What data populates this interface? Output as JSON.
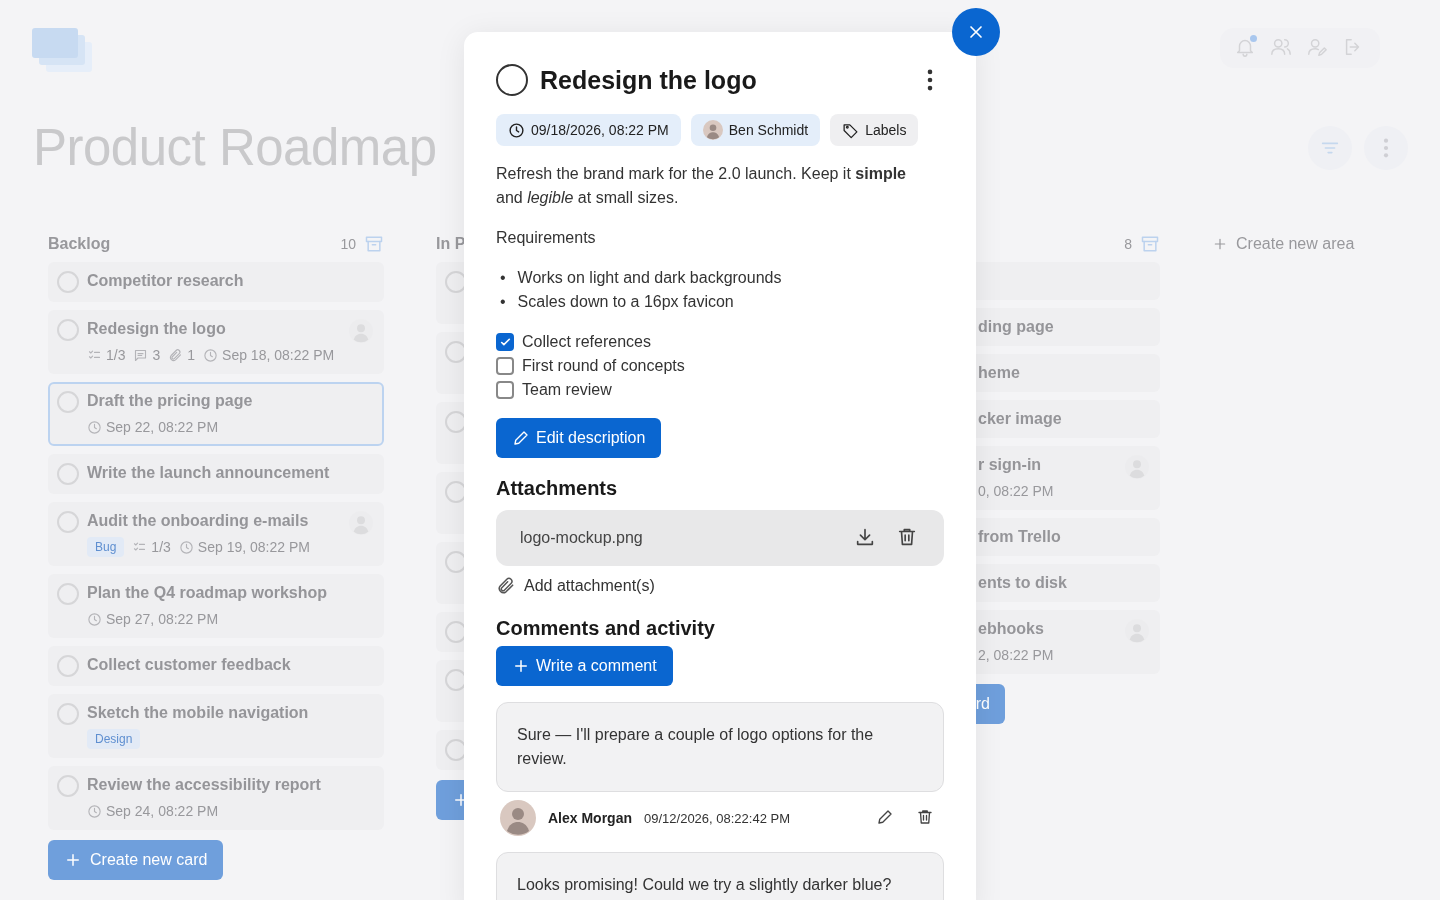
{
  "board": {
    "title": "Product Roadmap"
  },
  "header_actions": [
    {
      "kind": "notifications",
      "unread": true
    },
    {
      "kind": "members"
    },
    {
      "kind": "profile"
    },
    {
      "kind": "logout"
    }
  ],
  "board_actions": [
    {
      "kind": "filter"
    },
    {
      "kind": "more"
    }
  ],
  "columns": [
    {
      "kind": "full",
      "title": "Backlog",
      "count": "10",
      "add_button": {
        "kind": "full",
        "label": "Create new card"
      },
      "cards": [
        {
          "title": "Competitor research",
          "done": false,
          "selected": false,
          "assigned": false
        },
        {
          "title": "Redesign the logo",
          "done": false,
          "selected": false,
          "assigned": true,
          "meta": [
            {
              "kind": "checklist",
              "text": "1/3"
            },
            {
              "kind": "comments",
              "text": "3"
            },
            {
              "kind": "attachments",
              "text": "1"
            },
            {
              "kind": "due",
              "text": "Sep 18, 08:22 PM"
            }
          ]
        },
        {
          "title": "Draft the pricing page",
          "done": false,
          "selected": true,
          "assigned": false,
          "meta": [
            {
              "kind": "due",
              "text": "Sep 22, 08:22 PM"
            }
          ]
        },
        {
          "title": "Write the launch announcement",
          "done": false,
          "selected": false,
          "assigned": false
        },
        {
          "title": "Audit the onboarding e-mails",
          "done": false,
          "selected": false,
          "assigned": true,
          "meta": [
            {
              "kind": "tag",
              "text": "Bug"
            },
            {
              "kind": "checklist",
              "text": "1/3"
            },
            {
              "kind": "due",
              "text": "Sep 19, 08:22 PM"
            }
          ]
        },
        {
          "title": "Plan the Q4 roadmap workshop",
          "done": false,
          "selected": false,
          "assigned": false,
          "meta": [
            {
              "kind": "due",
              "text": "Sep 27, 08:22 PM"
            }
          ]
        },
        {
          "title": "Collect customer feedback",
          "done": false,
          "selected": false,
          "assigned": false
        },
        {
          "title": "Sketch the mobile navigation",
          "done": false,
          "selected": false,
          "assigned": false,
          "meta": [
            {
              "kind": "tag",
              "text": "Design"
            }
          ]
        },
        {
          "title": "Review the accessibility report",
          "done": false,
          "selected": false,
          "assigned": false,
          "meta": [
            {
              "kind": "due",
              "text": "Sep 24, 08:22 PM"
            }
          ]
        }
      ]
    },
    {
      "kind": "cut-right",
      "title": "In P",
      "add_button": {
        "kind": "icon"
      },
      "cards": [
        {
          "kind": "tall",
          "done": false
        },
        {
          "kind": "tall",
          "done": false
        },
        {
          "kind": "tall",
          "done": false
        },
        {
          "kind": "tall",
          "done": false
        },
        {
          "kind": "tall",
          "done": false
        },
        {
          "kind": "short",
          "done": false
        },
        {
          "kind": "tall",
          "done": false
        },
        {
          "kind": "short",
          "done": false
        }
      ]
    },
    {
      "kind": "cut-left",
      "count": "8",
      "add_button": {
        "kind": "full",
        "label": "rd"
      },
      "cards": [
        {
          "kind": "short",
          "assigned": false
        },
        {
          "title": "ding page",
          "assigned": false
        },
        {
          "title": "heme",
          "assigned": false
        },
        {
          "title": "cker image",
          "assigned": false
        },
        {
          "title": "r sign-in",
          "assigned": true,
          "meta": [
            {
              "kind": "text",
              "text": "0, 08:22 PM"
            }
          ]
        },
        {
          "title": "from Trello",
          "assigned": false
        },
        {
          "title": "ents to disk",
          "assigned": false
        },
        {
          "title": "ebhooks",
          "assigned": true,
          "meta": [
            {
              "kind": "text",
              "text": "2, 08:22 PM"
            }
          ]
        }
      ]
    }
  ],
  "create_area": "Create new area",
  "task_dialog": {
    "title": "Redesign the logo",
    "completed": false,
    "due_date": "09/18/2026, 08:22 PM",
    "assignee": "Ben Schmidt",
    "labels_button": "Labels",
    "description": "Refresh the brand mark for the 2.0 launch. Keep it **simple** and *legible* at small sizes.",
    "requirements_heading": "Requirements",
    "bullets": [
      {
        "marker": "•",
        "text": "Works on light and dark backgrounds"
      },
      {
        "marker": "•",
        "text": "Scales down to a 16px favicon"
      }
    ],
    "checklist": [
      {
        "label": "Collect references",
        "checked": true
      },
      {
        "label": "First round of concepts",
        "checked": false
      },
      {
        "label": "Team review",
        "checked": false
      }
    ],
    "edit_button": "Edit description",
    "attachments_heading": "Attachments",
    "attachments": [
      {
        "name": "logo-mockup.png"
      }
    ],
    "add_attachment": "Add attachment(s)",
    "comments_heading": "Comments and activity",
    "write_comment_button": "Write a comment",
    "comments": [
      {
        "text": "Sure — I'll prepare a couple of logo options for the review.",
        "author": "Alex Morgan",
        "time": "09/12/2026, 08:22:42 PM"
      },
      {
        "text": "Looks promising! Could we try a slightly darker blue?"
      }
    ]
  }
}
